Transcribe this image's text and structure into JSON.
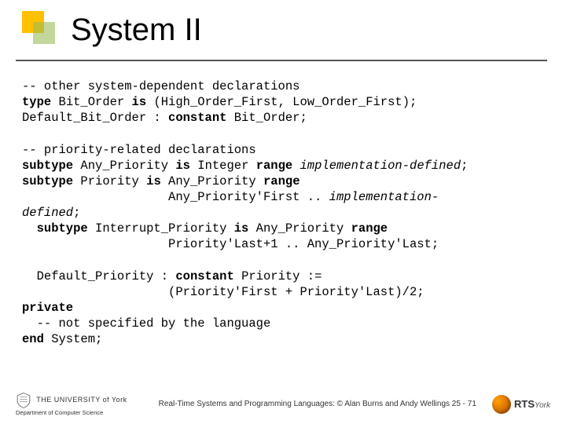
{
  "title": "System II",
  "code": {
    "c1": "-- other system-dependent declarations",
    "c2a": "type",
    "c2b": " Bit_Order ",
    "c2c": "is",
    "c2d": " (High_Order_First, Low_Order_First);",
    "c3a": "Default_Bit_Order : ",
    "c3b": "constant",
    "c3c": " Bit_Order;",
    "c4": "-- priority-related declarations",
    "c5a": "subtype",
    "c5b": " Any_Priority ",
    "c5c": "is",
    "c5d": " Integer ",
    "c5e": "range",
    "c5f": " implementation-defined",
    "c5g": ";",
    "c6a": "subtype",
    "c6b": " Priority ",
    "c6c": "is",
    "c6d": " Any_Priority ",
    "c6e": "range",
    "c7a": "                    Any_Priority'First .. ",
    "c7b": "implementation-",
    "c8": "defined",
    "c8b": ";",
    "c9a": "  subtype",
    "c9b": " Interrupt_Priority ",
    "c9c": "is",
    "c9d": " Any_Priority ",
    "c9e": "range",
    "c10": "                    Priority'Last+1 .. Any_Priority'Last;",
    "c11a": "  Default_Priority : ",
    "c11b": "constant",
    "c11c": " Priority :=",
    "c12": "                    (Priority'First + Priority'Last)/2;",
    "c13": "private",
    "c14": "  -- not specified by the language",
    "c15a": "end",
    "c15b": " System;"
  },
  "footer": {
    "university_line1": "THE UNIVERSITY of York",
    "university_line2": "Department of Computer Science",
    "center": "Real-Time Systems and Programming Languages: © Alan Burns and Andy Wellings 25 - 71",
    "rts": "RTS",
    "rts_sub": "York"
  }
}
